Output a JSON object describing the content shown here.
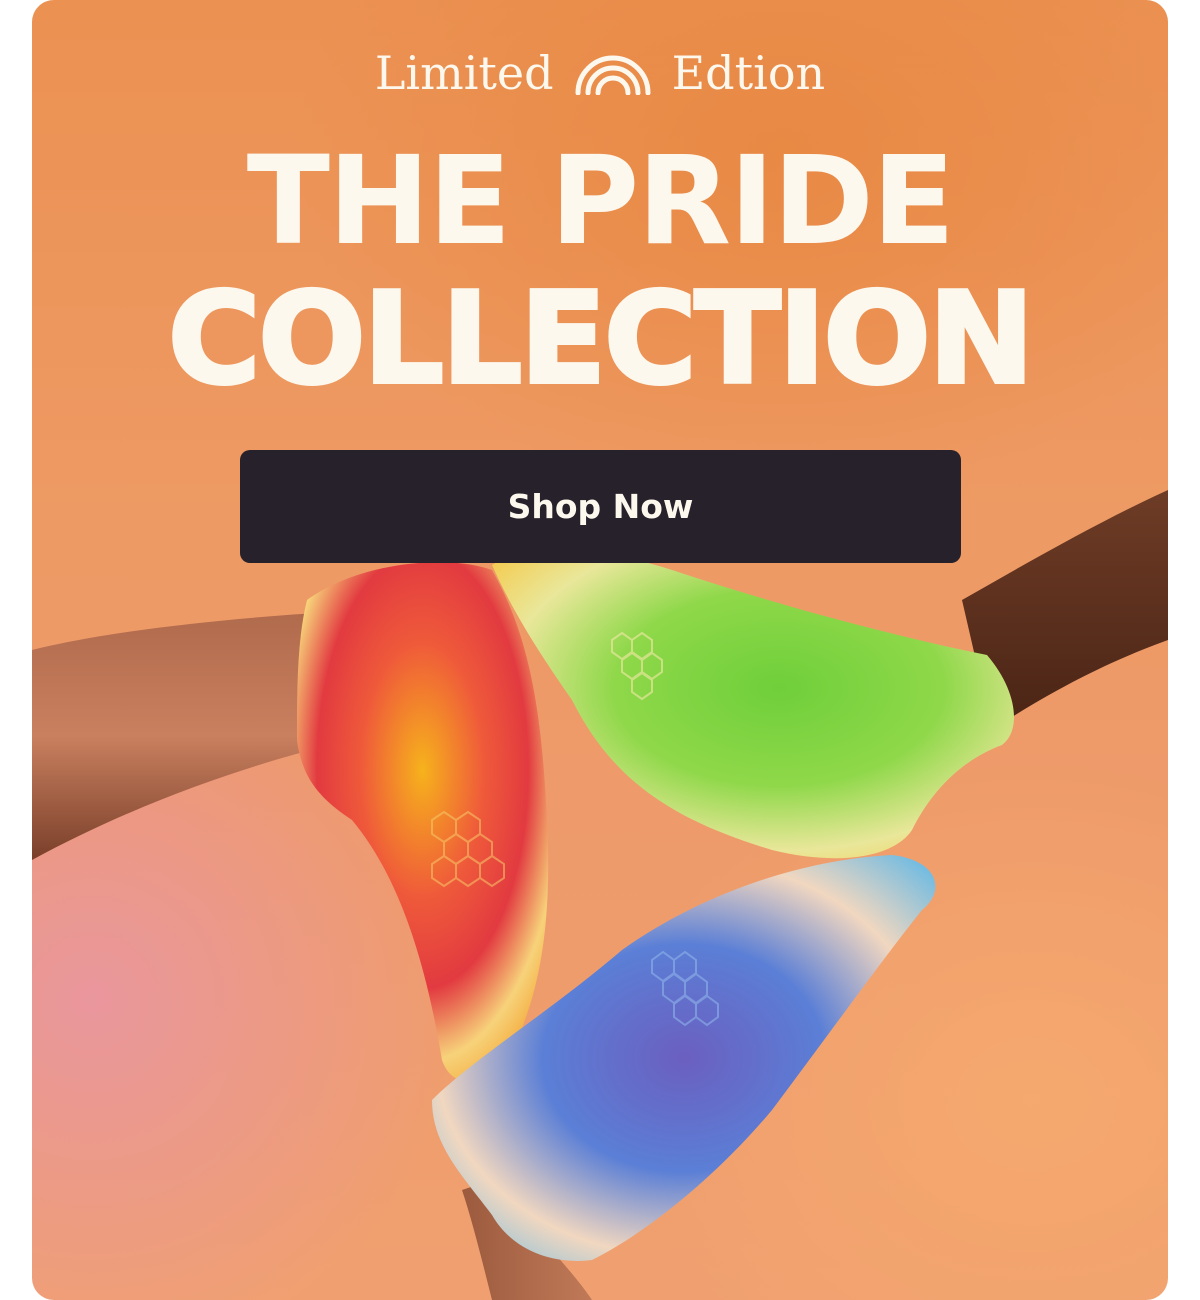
{
  "promo": {
    "eyebrow_left": "Limited",
    "eyebrow_right": "Edtion",
    "eyebrow_icon": "rainbow-icon",
    "headline_line1": "THE PRIDE",
    "headline_line2": "COLLECTION",
    "cta_label": "Shop Now"
  },
  "colors": {
    "background": "#ee9a64",
    "text_cream": "#fdf8ee",
    "button": "#26212a"
  }
}
